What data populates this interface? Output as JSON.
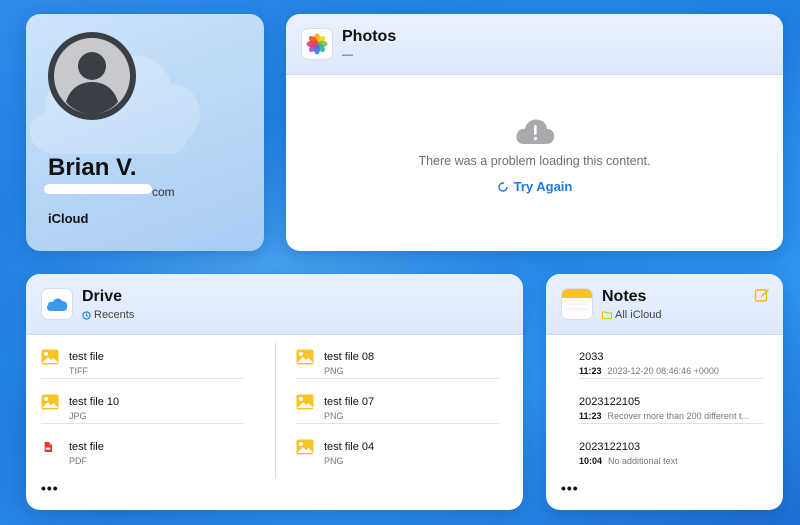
{
  "profile": {
    "name": "Brian V.",
    "email": "com",
    "service": "iCloud"
  },
  "photos": {
    "title": "Photos",
    "subtitle": "—",
    "error_message": "There was a problem loading this content.",
    "try_again_label": "Try Again"
  },
  "drive": {
    "title": "Drive",
    "subtitle": "Recents",
    "more_label": "•••",
    "left_files": [
      {
        "name": "test file",
        "type": "TIFF",
        "icon": "image-file-icon"
      },
      {
        "name": "test file 10",
        "type": "JPG",
        "icon": "image-file-icon"
      },
      {
        "name": "test file",
        "type": "PDF",
        "icon": "pdf-file-icon"
      }
    ],
    "right_files": [
      {
        "name": "test file 08",
        "type": "PNG",
        "icon": "image-file-icon"
      },
      {
        "name": "test file 07",
        "type": "PNG",
        "icon": "image-file-icon"
      },
      {
        "name": "test file 04",
        "type": "PNG",
        "icon": "image-file-icon"
      }
    ]
  },
  "notes": {
    "title": "Notes",
    "subtitle": "All iCloud",
    "more_label": "•••",
    "items": [
      {
        "title": "2033",
        "time": "11:23",
        "preview": "2023-12-20 08:46:46 +0000"
      },
      {
        "title": "2023122105",
        "time": "11:23",
        "preview": "Recover more than 200 different t..."
      },
      {
        "title": "2023122103",
        "time": "10:04",
        "preview": "No additional text"
      }
    ]
  },
  "colors": {
    "accent": "#1a7ae6",
    "notes_accent": "#f5b800",
    "image_icon": "#f7c325",
    "pdf_icon": "#e8382f"
  }
}
